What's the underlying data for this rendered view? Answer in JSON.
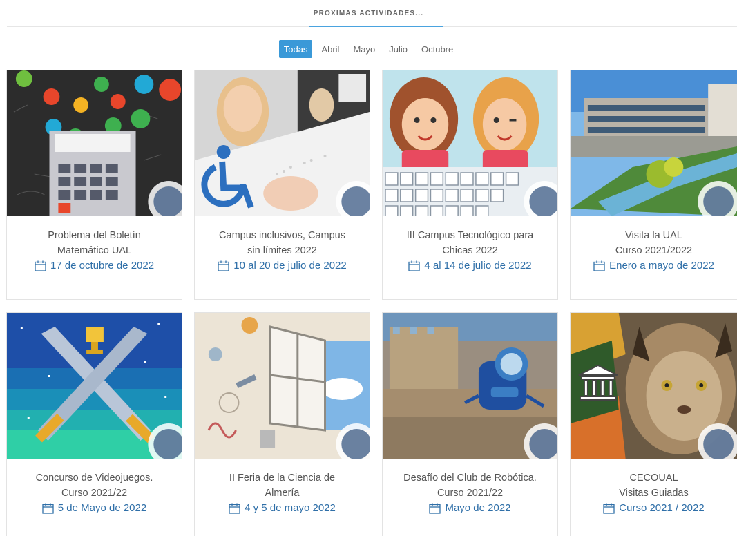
{
  "header": {
    "title": "PROXIMAS ACTIVIDADES..."
  },
  "filters": [
    {
      "label": "Todas",
      "active": true
    },
    {
      "label": "Abril",
      "active": false
    },
    {
      "label": "Mayo",
      "active": false
    },
    {
      "label": "Julio",
      "active": false
    },
    {
      "label": "Octubre",
      "active": false
    }
  ],
  "cards": [
    {
      "title_line1": "Problema del Boletín",
      "title_line2": "Matemático UAL",
      "date": "17 de octubre de 2022",
      "image": "math-calculator-image"
    },
    {
      "title_line1": "Campus inclusivos, Campus",
      "title_line2": "sin límites 2022",
      "date": "10 al 20 de julio de 2022",
      "image": "inclusive-campus-image"
    },
    {
      "title_line1": "III Campus Tecnológico para",
      "title_line2": "Chicas 2022",
      "date": "4 al 14 de julio de 2022",
      "image": "girls-keyboard-image"
    },
    {
      "title_line1": "Visita la UAL",
      "title_line2": "Curso 2021/2022",
      "date": "Enero a mayo de 2022",
      "image": "university-campus-image"
    },
    {
      "title_line1": "Concurso de Videojuegos.",
      "title_line2": "Curso 2021/22",
      "date": "5 de Mayo de 2022",
      "image": "crossed-swords-image"
    },
    {
      "title_line1": "II Feria de la Ciencia de",
      "title_line2": "Almería",
      "date": "4 y 5 de mayo 2022",
      "image": "science-window-image"
    },
    {
      "title_line1": "Desafío del Club de Robótica.",
      "title_line2": "Curso 2021/22",
      "date": "Mayo de 2022",
      "image": "robot-castle-image"
    },
    {
      "title_line1": "CECOUAL",
      "title_line2": "Visitas Guiadas",
      "date": "Curso 2021 / 2022",
      "image": "lynx-image"
    }
  ],
  "colors": {
    "accent": "#3a99d8",
    "date_text": "#2f6fa8",
    "title_text": "#555555"
  }
}
